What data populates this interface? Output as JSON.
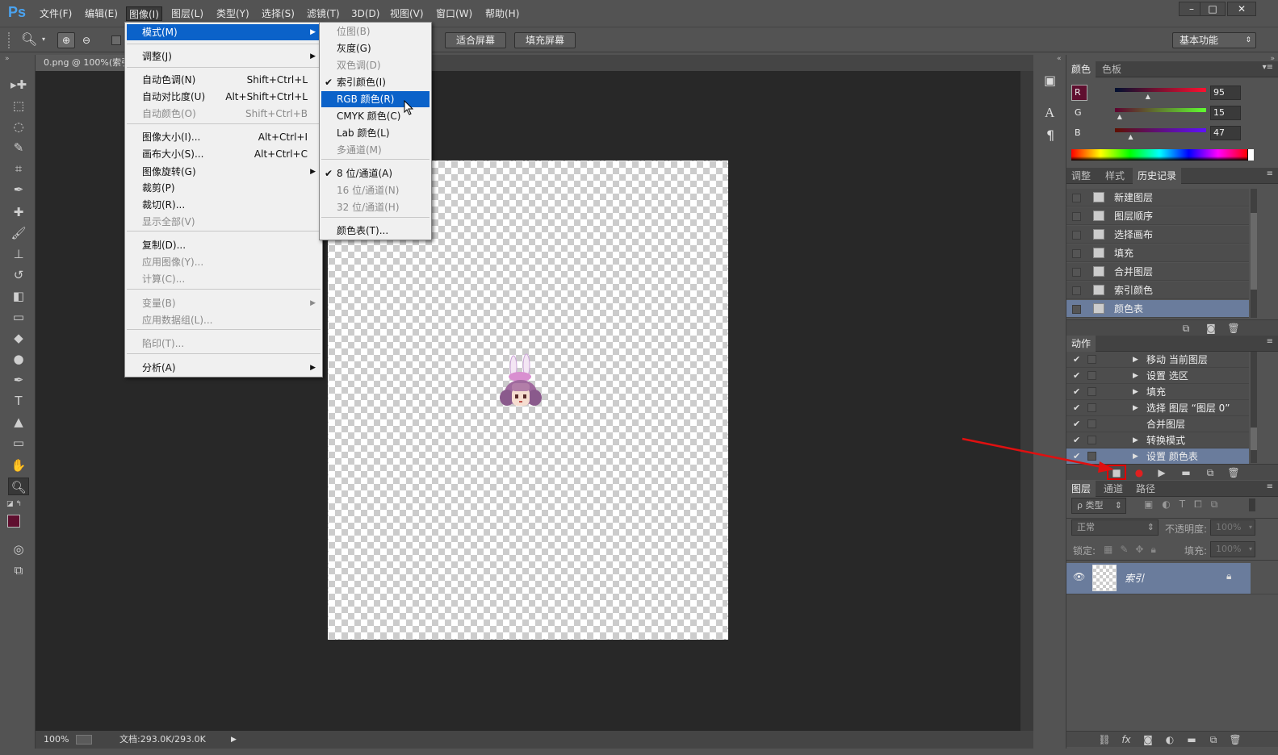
{
  "app": {
    "logo": "Ps"
  },
  "menubar": {
    "items": [
      "文件(F)",
      "编辑(E)",
      "图像(I)",
      "图层(L)",
      "类型(Y)",
      "选择(S)",
      "滤镜(T)",
      "3D(D)",
      "视图(V)",
      "窗口(W)",
      "帮助(H)"
    ],
    "window_buttons": [
      "–",
      "□",
      "✕"
    ]
  },
  "options": {
    "fit_screen": "适合屏幕",
    "fill_screen": "填充屏幕",
    "workspace": "基本功能"
  },
  "document": {
    "tab": "0.png @ 100%(索引"
  },
  "status": {
    "zoom": "100%",
    "doc": "文档:293.0K/293.0K"
  },
  "image_menu": {
    "items": [
      {
        "label": "模式(M)",
        "shortcut": "",
        "submenu": true,
        "disabled": false,
        "hl": true
      },
      {
        "label": "调整(J)",
        "shortcut": "",
        "submenu": true,
        "disabled": false
      },
      {
        "label": "自动色调(N)",
        "shortcut": "Shift+Ctrl+L",
        "disabled": false
      },
      {
        "label": "自动对比度(U)",
        "shortcut": "Alt+Shift+Ctrl+L",
        "disabled": false
      },
      {
        "label": "自动颜色(O)",
        "shortcut": "Shift+Ctrl+B",
        "disabled": true
      },
      {
        "label": "图像大小(I)...",
        "shortcut": "Alt+Ctrl+I",
        "disabled": false
      },
      {
        "label": "画布大小(S)...",
        "shortcut": "Alt+Ctrl+C",
        "disabled": false
      },
      {
        "label": "图像旋转(G)",
        "shortcut": "",
        "submenu": true,
        "disabled": false
      },
      {
        "label": "裁剪(P)",
        "shortcut": "",
        "disabled": false
      },
      {
        "label": "裁切(R)...",
        "shortcut": "",
        "disabled": false
      },
      {
        "label": "显示全部(V)",
        "shortcut": "",
        "disabled": true
      },
      {
        "label": "复制(D)...",
        "shortcut": "",
        "disabled": false
      },
      {
        "label": "应用图像(Y)...",
        "shortcut": "",
        "disabled": true
      },
      {
        "label": "计算(C)...",
        "shortcut": "",
        "disabled": true
      },
      {
        "label": "变量(B)",
        "shortcut": "",
        "submenu": true,
        "disabled": true
      },
      {
        "label": "应用数据组(L)...",
        "shortcut": "",
        "disabled": true
      },
      {
        "label": "陷印(T)...",
        "shortcut": "",
        "disabled": true
      },
      {
        "label": "分析(A)",
        "shortcut": "",
        "submenu": true,
        "disabled": false
      }
    ]
  },
  "mode_menu": {
    "items": [
      {
        "label": "位图(B)",
        "disabled": true
      },
      {
        "label": "灰度(G)",
        "disabled": false
      },
      {
        "label": "双色调(D)",
        "disabled": true
      },
      {
        "label": "索引颜色(I)",
        "disabled": false,
        "checked": true
      },
      {
        "label": "RGB 颜色(R)",
        "disabled": false,
        "hl": true
      },
      {
        "label": "CMYK 颜色(C)",
        "disabled": false
      },
      {
        "label": "Lab 颜色(L)",
        "disabled": false
      },
      {
        "label": "多通道(M)",
        "disabled": true
      },
      {
        "label": "8 位/通道(A)",
        "disabled": false,
        "checked": true
      },
      {
        "label": "16 位/通道(N)",
        "disabled": true
      },
      {
        "label": "32 位/通道(H)",
        "disabled": true
      },
      {
        "label": "颜色表(T)...",
        "disabled": false
      }
    ]
  },
  "color_panel": {
    "tabs": [
      "颜色",
      "色板"
    ],
    "r_label": "R",
    "g_label": "G",
    "b_label": "B",
    "r": "95",
    "g": "15",
    "b": "47",
    "r_level": 0.37,
    "g_level": 0.06,
    "b_level": 0.18,
    "fg": "#5f0f2f"
  },
  "history_panel": {
    "tabs": [
      "调整",
      "样式",
      "历史记录"
    ],
    "items": [
      "新建图层",
      "图层顺序",
      "选择画布",
      "填充",
      "合并图层",
      "索引颜色",
      "颜色表"
    ]
  },
  "actions_panel": {
    "tab": "动作",
    "items": [
      {
        "label": "移动 当前图层",
        "expand": true
      },
      {
        "label": "设置 选区",
        "expand": true
      },
      {
        "label": "填充",
        "expand": true
      },
      {
        "label": "选择 图层 “图层 0”",
        "expand": true
      },
      {
        "label": "合并图层",
        "expand": false
      },
      {
        "label": "转换模式",
        "expand": true
      },
      {
        "label": "设置 颜色表",
        "expand": true
      }
    ]
  },
  "layers_panel": {
    "tabs": [
      "图层",
      "通道",
      "路径"
    ],
    "filter": "ρ 类型",
    "blend": "正常",
    "opacity_label": "不透明度:",
    "opacity": "100%",
    "lock_label": "锁定:",
    "fill_label": "填充:",
    "fill": "100%",
    "layer_name": "索引"
  }
}
